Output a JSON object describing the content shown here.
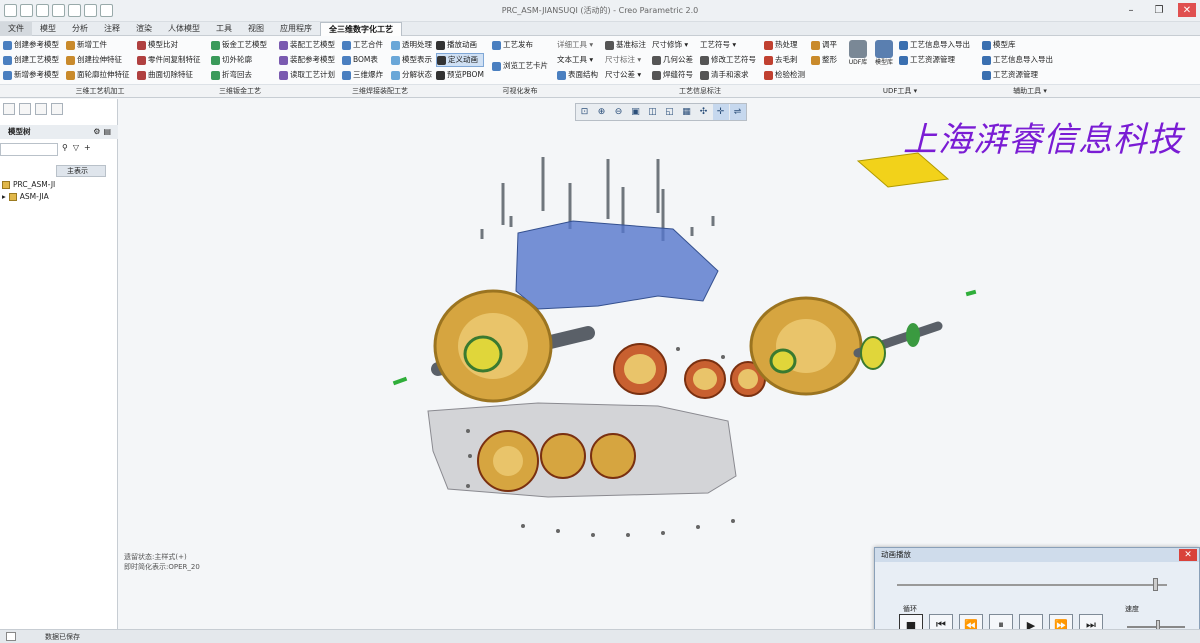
{
  "window": {
    "title": "PRC_ASM-JIANSUQI (活动的) - Creo Parametric 2.0"
  },
  "tabs": [
    "文件",
    "模型",
    "分析",
    "注释",
    "渲染",
    "人体模型",
    "工具",
    "视图",
    "应用程序",
    "全三维数字化工艺"
  ],
  "ribbon": {
    "col1": [
      "创建参考模型",
      "创建工艺模型",
      "新增参考模型"
    ],
    "col2": [
      "新增工件",
      "创建拉伸特征",
      "面轮廓拉伸特征"
    ],
    "col3": [
      "模型比对",
      "零件间复制特征",
      "曲面切除特征"
    ],
    "col4": [
      "钣金工艺模型",
      "切外轮廓",
      "折弯回去"
    ],
    "col5": [
      "装配工艺模型",
      "装配参考模型",
      "读取工艺计划"
    ],
    "col6": [
      "工艺合件",
      "BOM表",
      "三维爆炸"
    ],
    "col7": [
      "透明处理",
      "模型表示",
      "分解状态"
    ],
    "col8": [
      "播放动画",
      "定义动画",
      "预览PBOM"
    ],
    "col9": [
      "工艺发布",
      "浏览工艺卡片"
    ],
    "col10": [
      "详细工具",
      "文本工具",
      "表面结构"
    ],
    "col11": [
      "基准标注",
      "尺寸标注",
      "尺寸公差"
    ],
    "col12": [
      "尺寸修饰",
      "几何公差",
      "焊缝符号"
    ],
    "col13": [
      "工艺符号",
      "修改工艺符号",
      "清手和滚求"
    ],
    "col14": [
      "热处理",
      "去毛刺",
      "检验检测"
    ],
    "col15": [
      "调平",
      "整形"
    ],
    "big1": "UDF库",
    "big2": "模型库",
    "col16": [
      "工艺信息导入导出",
      "工艺资源管理"
    ],
    "col17": [
      "模型库",
      "工艺信息导入导出",
      "工艺资源管理"
    ]
  },
  "groups": [
    "三维工艺机加工",
    "三维钣金工艺",
    "三维焊接装配工艺",
    "可视化发布",
    "工艺信息标注",
    "UDF工具 ▾",
    "辅助工具 ▾"
  ],
  "leftpanel": {
    "header": "模型树",
    "main_label": "主表示",
    "tree": [
      "PRC_ASM-JI",
      "ASM-JIA"
    ]
  },
  "watermark": "上海湃睿信息科技",
  "status": [
    "遗留状态:主样式(+)",
    "即时简化表示:OPER_20"
  ],
  "statusbar": "数据已保存",
  "dialog": {
    "title": "动画播放",
    "loop": "循环",
    "speed": "速度"
  }
}
